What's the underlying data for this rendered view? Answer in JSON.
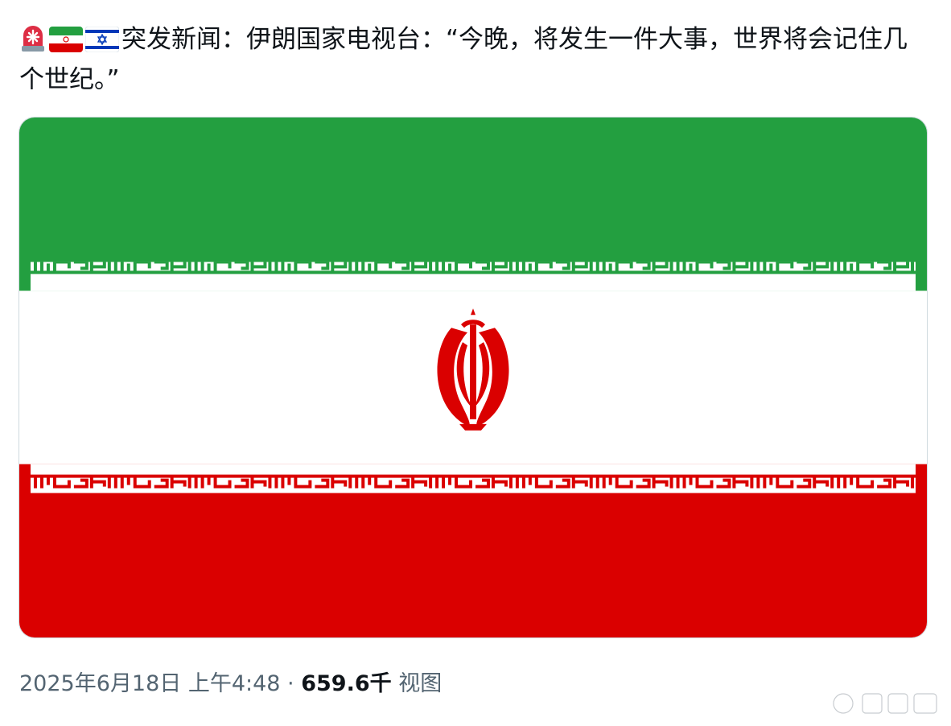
{
  "tweet": {
    "emojis": [
      "rotating-light-icon",
      "iran-flag-icon",
      "israel-flag-icon"
    ],
    "text": "突发新闻：伊朗国家电视台：“今晚，将发生一件大事，世界将会记住几个世纪。”",
    "media": {
      "alt": "",
      "colors": {
        "green": "#239f40",
        "white": "#ffffff",
        "red": "#da0000"
      }
    },
    "meta": {
      "timestamp": "2025年6月18日 上午4:48",
      "separator": " · ",
      "views_count": "659.6千",
      "views_label": "视图"
    }
  },
  "watermark": {
    "icon": "weibo-watermark-icon"
  }
}
